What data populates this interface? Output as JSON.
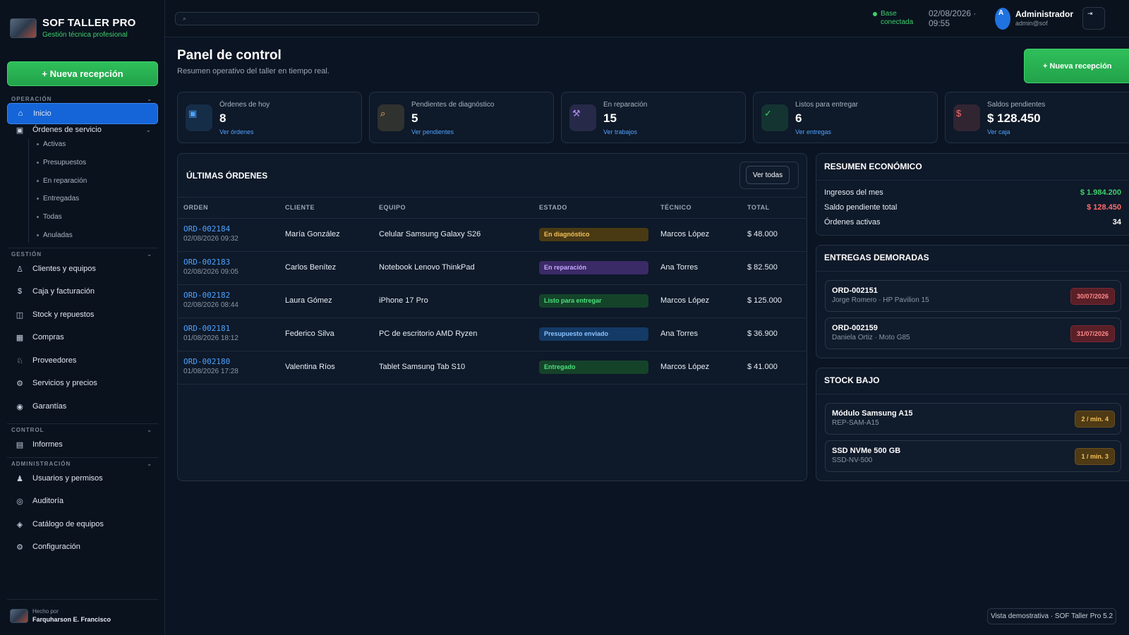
{
  "brand": {
    "title": "SOF TALLER PRO",
    "subtitle": "Gestión técnica profesional"
  },
  "sidebar": {
    "new_button": "+ Nueva recepción",
    "sections": {
      "operacion": "OPERACIÓN",
      "gestion": "GESTIÓN",
      "control": "CONTROL",
      "administracion": "ADMINISTRACIÓN"
    },
    "items": {
      "inicio": "Inicio",
      "ordenes": "Órdenes de servicio",
      "clientes": "Clientes y equipos",
      "caja": "Caja y facturación",
      "stock": "Stock y repuestos",
      "compras": "Compras",
      "proveedores": "Proveedores",
      "servicios": "Servicios y precios",
      "garantias": "Garantías",
      "informes": "Informes",
      "usuarios": "Usuarios y permisos",
      "auditoria": "Auditoría",
      "catalogo": "Catálogo de equipos",
      "configuracion": "Configuración"
    },
    "subitems": [
      "Activas",
      "Presupuestos",
      "En reparación",
      "Entregadas",
      "Todas",
      "Anuladas"
    ],
    "footer": {
      "made_by": "Hecho por",
      "author": "Farquharson E. Francisco"
    }
  },
  "topbar": {
    "search_icon": "⌕",
    "db_status": "Base conectada",
    "datetime": "02/08/2026 · 09:55",
    "avatar": "A",
    "user_name": "Administrador",
    "user_email": "admin@sof",
    "logout_icon": "⇥"
  },
  "page": {
    "title": "Panel de control",
    "subtitle": "Resumen operativo del taller en tiempo real.",
    "new_button": "+ Nueva recepción"
  },
  "kpis": [
    {
      "label": "Órdenes de hoy",
      "value": "8",
      "link": "Ver órdenes",
      "icon": "▣",
      "color": "#4da3ff"
    },
    {
      "label": "Pendientes de diagnóstico",
      "value": "5",
      "link": "Ver pendientes",
      "icon": "⌕",
      "color": "#f5c25a"
    },
    {
      "label": "En reparación",
      "value": "15",
      "link": "Ver trabajos",
      "icon": "⚒",
      "color": "#b38cff"
    },
    {
      "label": "Listos para entregar",
      "value": "6",
      "link": "Ver entregas",
      "icon": "✓",
      "color": "#3fcf6b"
    },
    {
      "label": "Saldos pendientes",
      "value": "$ 128.450",
      "link": "Ver caja",
      "icon": "$",
      "color": "#ff6b6b"
    }
  ],
  "orders": {
    "title": "ÚLTIMAS ÓRDENES",
    "view_all": "Ver todas",
    "headers": [
      "ORDEN",
      "CLIENTE",
      "EQUIPO",
      "ESTADO",
      "TÉCNICO",
      "TOTAL"
    ],
    "rows": [
      {
        "id": "ORD-002184",
        "date": "02/08/2026 09:32",
        "client": "María González",
        "device": "Celular Samsung Galaxy S26",
        "status": "En diagnóstico",
        "tech": "Marcos López",
        "total": "$ 48.000"
      },
      {
        "id": "ORD-002183",
        "date": "02/08/2026 09:05",
        "client": "Carlos Benítez",
        "device": "Notebook Lenovo ThinkPad",
        "status": "En reparación",
        "tech": "Ana Torres",
        "total": "$ 82.500"
      },
      {
        "id": "ORD-002182",
        "date": "02/08/2026 08:44",
        "client": "Laura Gómez",
        "device": "iPhone 17 Pro",
        "status": "Listo para entregar",
        "tech": "Marcos López",
        "total": "$ 125.000"
      },
      {
        "id": "ORD-002181",
        "date": "01/08/2026 18:12",
        "client": "Federico Silva",
        "device": "PC de escritorio AMD Ryzen",
        "status": "Presupuesto enviado",
        "tech": "Ana Torres",
        "total": "$ 36.900"
      },
      {
        "id": "ORD-002180",
        "date": "01/08/2026 17:28",
        "client": "Valentina Ríos",
        "device": "Tablet Samsung Tab S10",
        "status": "Entregado",
        "tech": "Marcos López",
        "total": "$ 41.000"
      }
    ],
    "status_colors": {
      "En diagnóstico": {
        "bg": "#4a3a14",
        "fg": "#f5c25a"
      },
      "En reparación": {
        "bg": "#3a2a66",
        "fg": "#c8a8ff"
      },
      "Listo para entregar": {
        "bg": "#15432a",
        "fg": "#4be07a"
      },
      "Presupuesto enviado": {
        "bg": "#143a66",
        "fg": "#8cc4ff"
      },
      "Entregado": {
        "bg": "#15432a",
        "fg": "#4be07a"
      }
    }
  },
  "economic": {
    "title": "RESUMEN ECONÓMICO",
    "rows": [
      {
        "label": "Ingresos del mes",
        "value": "$ 1.984.200",
        "color": "#3fcf6b"
      },
      {
        "label": "Saldo pendiente total",
        "value": "$ 128.450",
        "color": "#ff6b6b"
      },
      {
        "label": "Órdenes activas",
        "value": "34",
        "color": "#ffffff"
      }
    ]
  },
  "delayed": {
    "title": "ENTREGAS DEMORADAS",
    "items": [
      {
        "id": "ORD-002151",
        "desc": "Jorge Romero · HP Pavilion 15",
        "date": "30/07/2026"
      },
      {
        "id": "ORD-002159",
        "desc": "Daniela Ortiz · Moto G85",
        "date": "31/07/2026"
      }
    ]
  },
  "low_stock": {
    "title": "STOCK BAJO",
    "items": [
      {
        "name": "Módulo Samsung A15",
        "code": "REP-SAM-A15",
        "qty": "2 / min. 4"
      },
      {
        "name": "SSD NVMe 500 GB",
        "code": "SSD-NV-500",
        "qty": "1 / min. 3"
      }
    ]
  },
  "demo_badge": "Vista demostrativa · SOF Taller Pro 5.2"
}
